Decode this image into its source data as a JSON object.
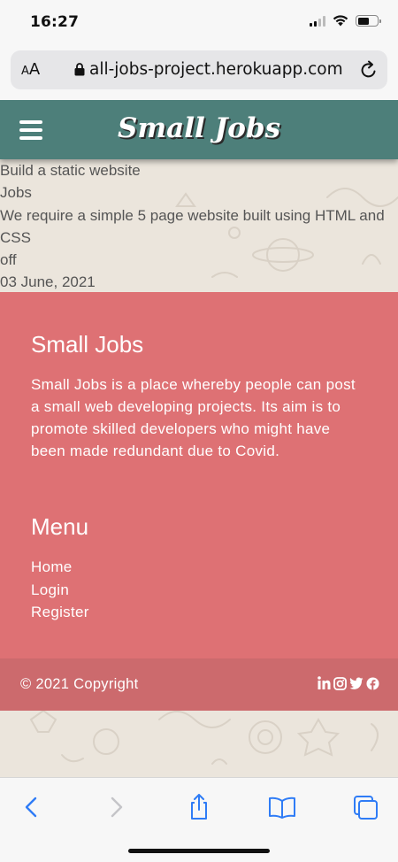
{
  "status_bar": {
    "time": "16:27"
  },
  "browser": {
    "aa_label_small": "A",
    "aa_label_large": "A",
    "url": "all-jobs-project.herokuapp.com"
  },
  "nav": {
    "brand": "Small Jobs"
  },
  "job": {
    "title": "Build a static website",
    "category": "Jobs",
    "description": "We require a simple 5 page website built using HTML and CSS",
    "status": "off",
    "date": "03 June, 2021"
  },
  "footer": {
    "title": "Small Jobs",
    "text": "Small Jobs is a place whereby people can post a small web developing projects. Its aim is to promote skilled developers who might have been made redundant due to Covid.",
    "menu_title": "Menu",
    "menu_links": [
      "Home",
      "Login",
      "Register"
    ],
    "copyright": "© 2021 Copyright",
    "social_icons": [
      "linkedin-icon",
      "instagram-icon",
      "twitter-icon",
      "facebook-icon"
    ]
  },
  "colors": {
    "nav_bg": "#4d7f7a",
    "footer_bg": "#de7174",
    "copyright_bg": "#cc6a6d",
    "page_bg": "#ebe5dc",
    "ios_blue": "#2f7cf6"
  }
}
